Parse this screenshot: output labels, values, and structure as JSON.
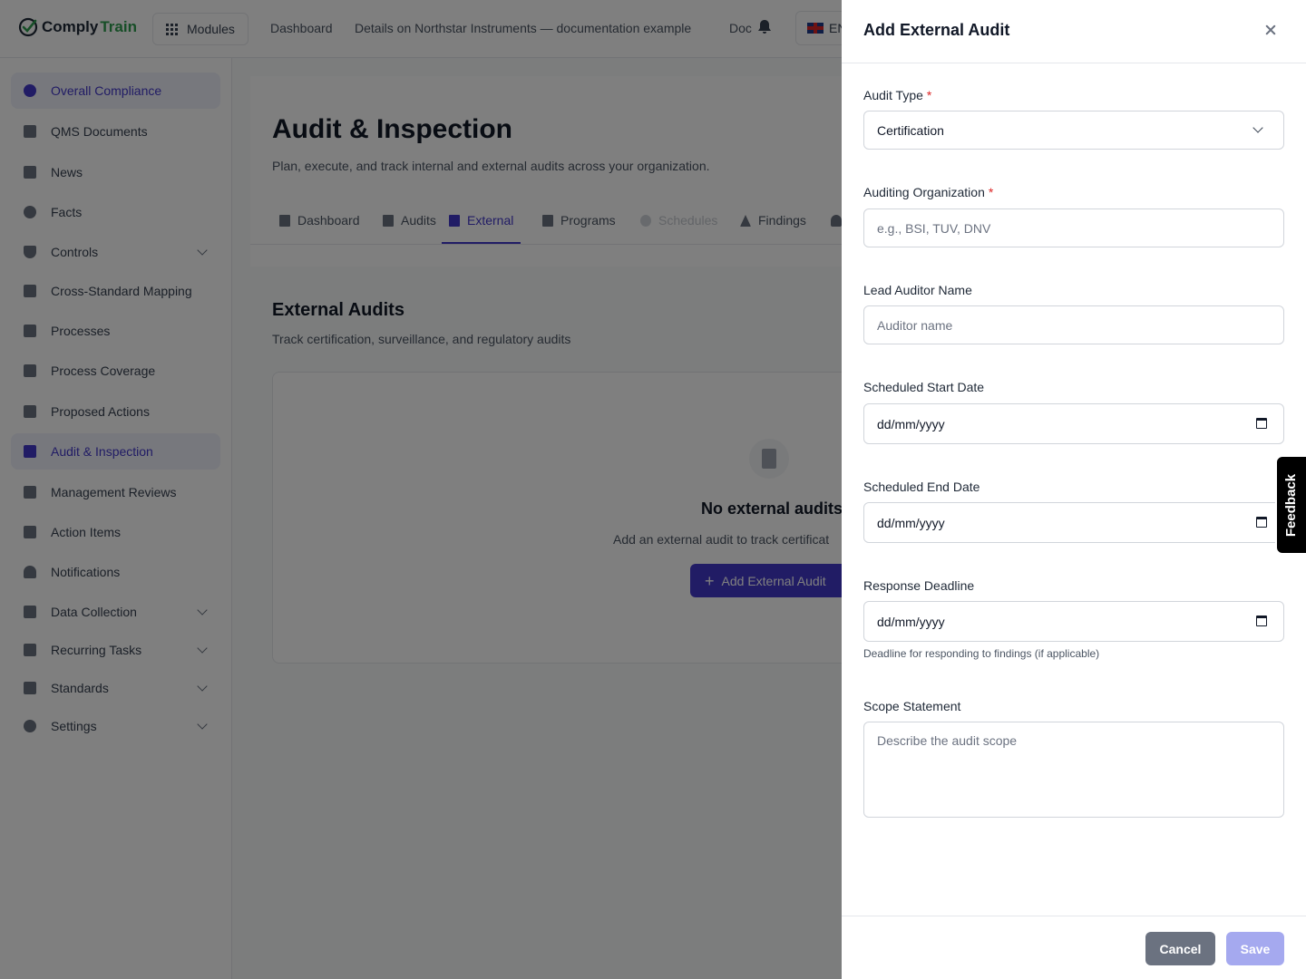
{
  "app": {
    "logo_part1": "Comply",
    "logo_part2": "Train",
    "modules_label": "Modules",
    "breadcrumb_1": "Dashboard",
    "breadcrumb_2": "Details on Northstar Instruments — documentation example",
    "breadcrumb_3": "Doc",
    "language": "EN",
    "accent_color": "#4338ca",
    "brand_color": "#2e9d4f"
  },
  "sidebar": {
    "items": [
      {
        "label": "Overall Compliance",
        "icon": "pie-chart-icon",
        "active": true
      },
      {
        "label": "QMS Documents",
        "icon": "document-icon"
      },
      {
        "label": "News",
        "icon": "megaphone-icon"
      },
      {
        "label": "Facts",
        "icon": "lightbulb-icon"
      },
      {
        "label": "Controls",
        "icon": "shield-icon",
        "expandable": true
      },
      {
        "label": "Cross-Standard Mapping",
        "icon": "table-grid-icon"
      },
      {
        "label": "Processes",
        "icon": "flow-icon"
      },
      {
        "label": "Process Coverage",
        "icon": "calendar-grid-icon"
      },
      {
        "label": "Proposed Actions",
        "icon": "list-check-icon"
      },
      {
        "label": "Audit & Inspection",
        "icon": "checklist-icon",
        "active": true
      },
      {
        "label": "Management Reviews",
        "icon": "chat-icon"
      },
      {
        "label": "Action Items",
        "icon": "tasks-icon"
      },
      {
        "label": "Notifications",
        "icon": "bell-icon"
      },
      {
        "label": "Data Collection",
        "icon": "clipboard-icon",
        "expandable": true
      },
      {
        "label": "Recurring Tasks",
        "icon": "repeat-icon",
        "expandable": true
      },
      {
        "label": "Standards",
        "icon": "bookmark-icon",
        "expandable": true
      },
      {
        "label": "Settings",
        "icon": "gear-icon",
        "expandable": true
      }
    ]
  },
  "main": {
    "title": "Audit & Inspection",
    "subtitle": "Plan, execute, and track internal and external audits across your organization.",
    "tabs": [
      {
        "label": "Dashboard"
      },
      {
        "label": "Audits"
      },
      {
        "label": "External",
        "active": true
      },
      {
        "label": "Programs"
      },
      {
        "label": "Schedules",
        "disabled": true
      },
      {
        "label": "Findings"
      }
    ],
    "section_title": "External Audits",
    "section_subtitle": "Track certification, surveillance, and regulatory audits",
    "empty_title": "No external audits",
    "empty_desc": "Add an external audit to track certificat",
    "empty_button": "Add External Audit"
  },
  "drawer": {
    "title": "Add External Audit",
    "audit_type_label": "Audit Type",
    "audit_type_value": "Certification",
    "org_label": "Auditing Organization",
    "org_placeholder": "e.g., BSI, TUV, DNV",
    "lead_label": "Lead Auditor Name",
    "lead_placeholder": "Auditor name",
    "start_label": "Scheduled Start Date",
    "start_value": "dd/mm/yyyy",
    "end_label": "Scheduled End Date",
    "end_value": "dd/mm/yyyy",
    "deadline_label": "Response Deadline",
    "deadline_value": "dd/mm/yyyy",
    "deadline_help": "Deadline for responding to findings (if applicable)",
    "scope_label": "Scope Statement",
    "scope_placeholder": "Describe the audit scope",
    "required_mark": "*",
    "cancel_label": "Cancel",
    "save_label": "Save"
  },
  "feedback_label": "Feedback"
}
